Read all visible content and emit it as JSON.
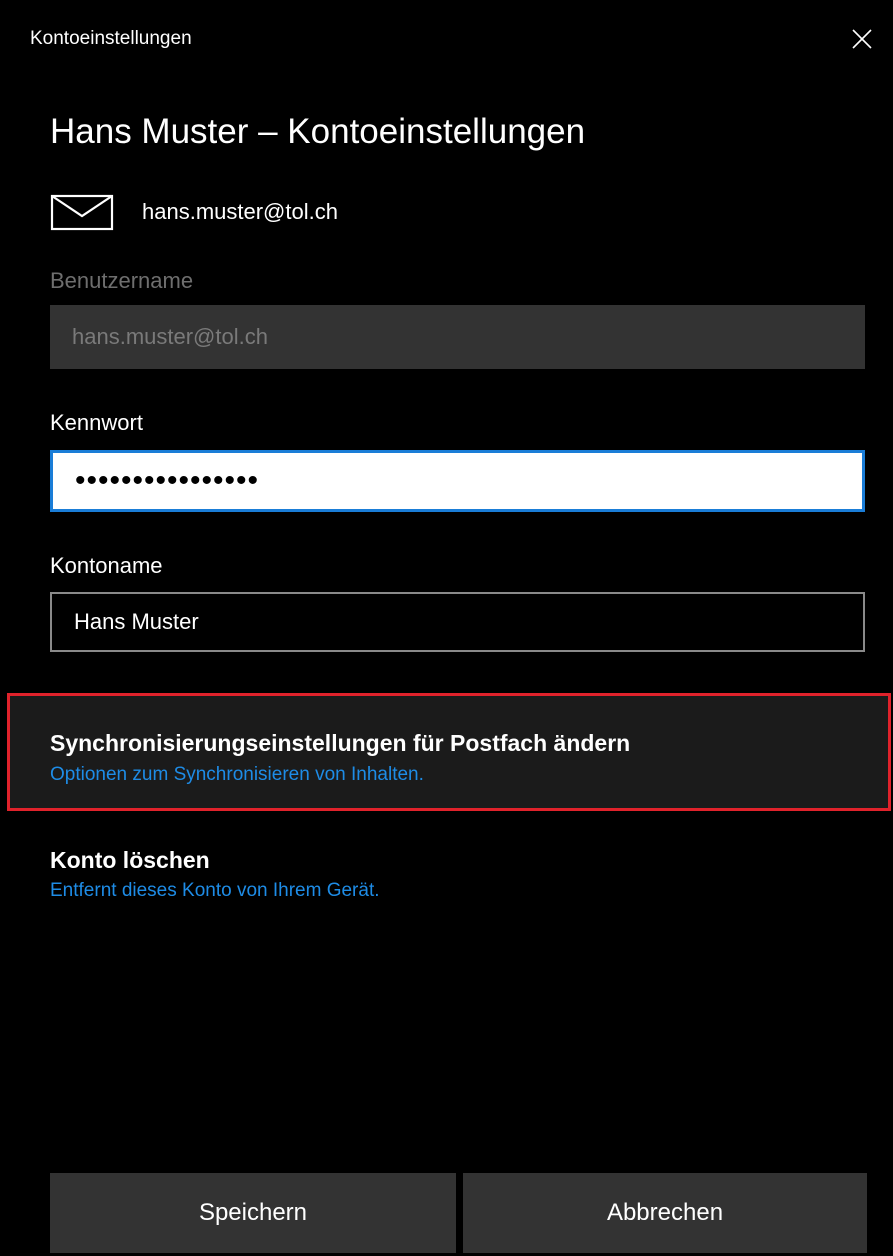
{
  "window": {
    "title": "Kontoeinstellungen",
    "close_icon": "close-icon"
  },
  "heading": "Hans Muster – Kontoeinstellungen",
  "account": {
    "icon": "mail-icon",
    "email": "hans.muster@tol.ch"
  },
  "fields": {
    "username": {
      "label": "Benutzername",
      "value": "hans.muster@tol.ch",
      "disabled": true
    },
    "password": {
      "label": "Kennwort",
      "value": "••••••••••••••••"
    },
    "account_name": {
      "label": "Kontoname",
      "value": "Hans Muster"
    }
  },
  "sync_settings": {
    "title": "Synchronisierungseinstellungen für Postfach ändern",
    "subtitle": "Optionen zum Synchronisieren von Inhalten.",
    "highlight_color": "#e0222b"
  },
  "delete_account": {
    "title": "Konto löschen",
    "subtitle": "Entfernt dieses Konto von Ihrem Gerät."
  },
  "buttons": {
    "save": "Speichern",
    "cancel": "Abbrechen"
  },
  "colors": {
    "background": "#000000",
    "accent": "#1a7dd7",
    "link": "#1e8ce6",
    "button": "#333333"
  }
}
